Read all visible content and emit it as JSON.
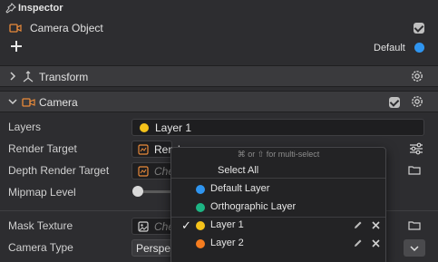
{
  "header": {
    "title": "Inspector",
    "object_name": "Camera Object",
    "layer_label": "Default",
    "layer_color": "#2f95f0",
    "object_enabled": true
  },
  "sections": {
    "transform": {
      "title": "Transform",
      "expanded": false
    },
    "camera": {
      "title": "Camera",
      "expanded": true,
      "enabled": true
    }
  },
  "camera": {
    "layers": {
      "label": "Layers",
      "value": "Layer 1",
      "color": "#f4c21a"
    },
    "render_target": {
      "label": "Render Target",
      "value": "Rende"
    },
    "depth_render_target": {
      "label": "Depth Render Target",
      "placeholder": "Che"
    },
    "mipmap_level": {
      "label": "Mipmap Level",
      "value": 0
    },
    "mask_texture": {
      "label": "Mask Texture",
      "placeholder": "Che"
    },
    "camera_type": {
      "label": "Camera Type",
      "value": "Perspe"
    }
  },
  "layer_popup": {
    "hint": "⌘ or ⇧ for multi-select",
    "select_all": "Select All",
    "items": [
      {
        "label": "Default Layer",
        "color": "#2f95f0",
        "checked": false,
        "editable": false
      },
      {
        "label": "Orthographic Layer",
        "color": "#1db584",
        "checked": false,
        "editable": false
      },
      {
        "label": "Layer 1",
        "color": "#f4c21a",
        "checked": true,
        "editable": true
      },
      {
        "label": "Layer 2",
        "color": "#f57c1f",
        "checked": false,
        "editable": true
      }
    ]
  },
  "icons": {
    "pin": "pin-icon",
    "camera": "camera-icon",
    "add": "plus-icon",
    "transform": "axes-icon",
    "settings": "gear-icon",
    "folder": "folder-icon",
    "texture": "image-icon",
    "sliders": "sliders-icon",
    "edit": "pencil-icon",
    "delete": "close-icon"
  }
}
